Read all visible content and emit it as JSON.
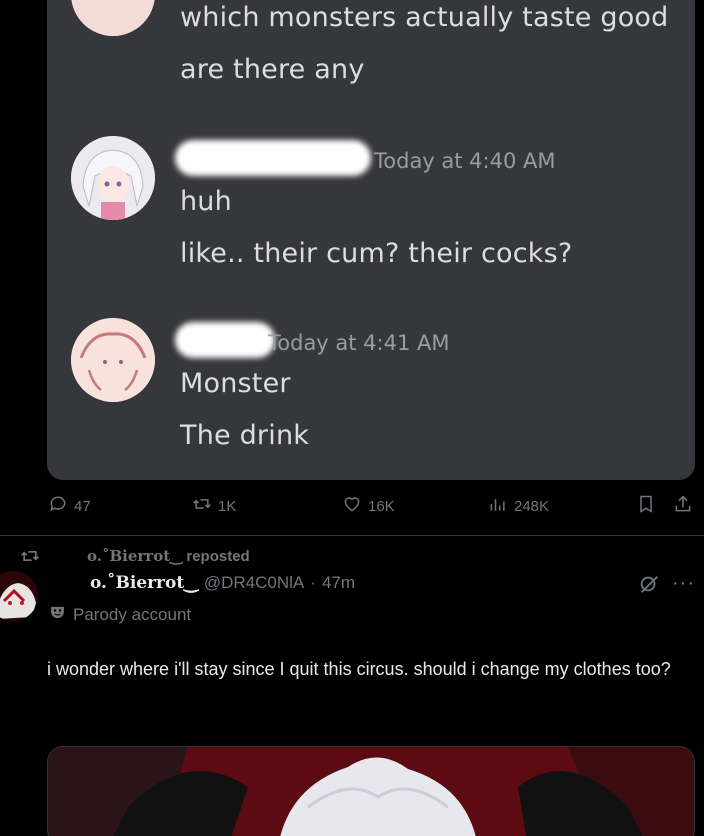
{
  "discord": {
    "messages": [
      {
        "line1": "which monsters actually taste good",
        "line2": "are there any"
      },
      {
        "time": "Today at 4:40 AM",
        "line1": "huh",
        "line2": "like.. their cum? their cocks?"
      },
      {
        "time": "Today at 4:41 AM",
        "line1": "Monster",
        "line2": "The drink"
      }
    ]
  },
  "actions": {
    "replies": "47",
    "reposts": "1K",
    "likes": "16K",
    "views": "248K"
  },
  "repost": {
    "name": "o.˚Bierrot‿",
    "label": "reposted"
  },
  "tweet": {
    "display_name": "o.˚Bierrot‿",
    "handle": "@DR4C0NlA",
    "separator": "·",
    "time": "47m",
    "parody_label": "Parody account",
    "text": "i wonder where i'll stay since I quit this circus. should i change my clothes too?"
  },
  "colors": {
    "background": "#000000",
    "muted": "#71767b",
    "text": "#e7e9ea",
    "discord_bg": "#36363d"
  }
}
